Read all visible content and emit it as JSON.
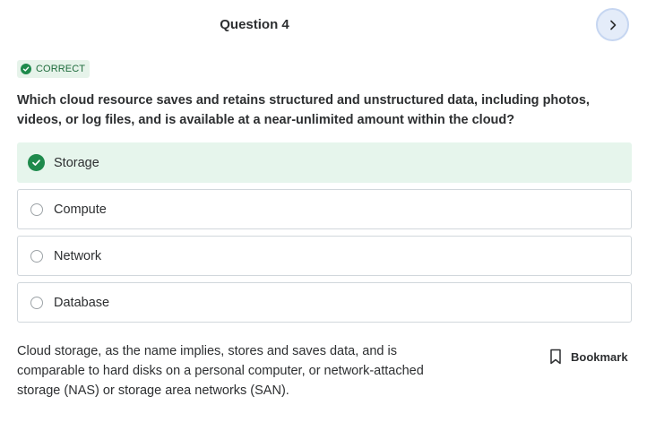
{
  "header": {
    "question_title": "Question 4",
    "next_icon": "chevron-right-icon"
  },
  "status": {
    "label": "CORRECT",
    "icon": "check-circle-icon",
    "color": "#1e8a4c"
  },
  "question": {
    "text": "Which cloud resource saves and retains structured and unstructured data, including photos, videos, or log files, and is available at a near-unlimited amount within the cloud?"
  },
  "options": [
    {
      "label": "Storage",
      "state": "correct"
    },
    {
      "label": "Compute",
      "state": "unselected"
    },
    {
      "label": "Network",
      "state": "unselected"
    },
    {
      "label": "Database",
      "state": "unselected"
    }
  ],
  "explanation": {
    "text": "Cloud storage, as the name implies, stores and saves data, and is comparable to hard disks on a personal computer, or network-attached storage (NAS) or storage area networks (SAN)."
  },
  "bookmark": {
    "label": "Bookmark",
    "icon": "bookmark-icon"
  }
}
